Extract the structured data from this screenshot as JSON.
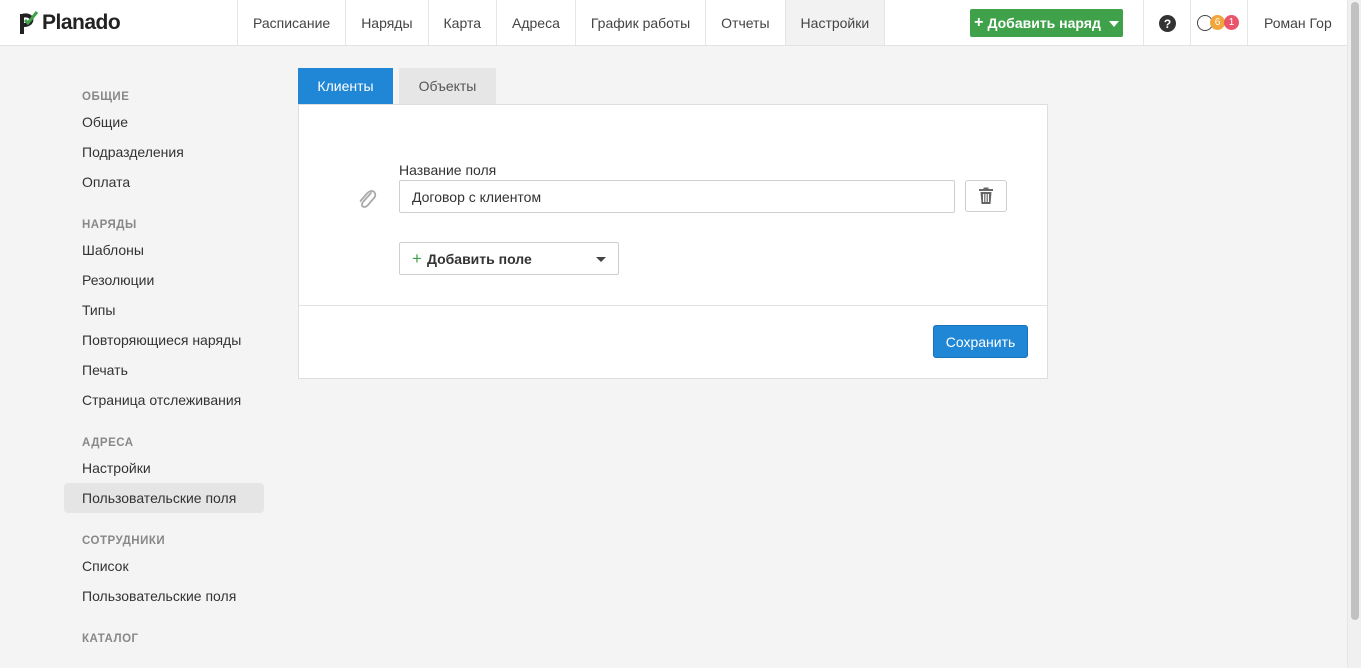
{
  "app": {
    "name": "Planado"
  },
  "nav": {
    "items": [
      {
        "label": "Расписание",
        "active": false
      },
      {
        "label": "Наряды",
        "active": false
      },
      {
        "label": "Карта",
        "active": false
      },
      {
        "label": "Адреса",
        "active": false
      },
      {
        "label": "График работы",
        "active": false
      },
      {
        "label": "Отчеты",
        "active": false
      },
      {
        "label": "Настройки",
        "active": true
      }
    ]
  },
  "header": {
    "add_order_label": "Добавить наряд",
    "help_label": "?",
    "badge_orange": "6",
    "badge_red": "1",
    "user_name": "Роман Гор"
  },
  "sidebar": {
    "sections": [
      {
        "title": "ОБЩИЕ",
        "items": [
          "Общие",
          "Подразделения",
          "Оплата"
        ]
      },
      {
        "title": "НАРЯДЫ",
        "items": [
          "Шаблоны",
          "Резолюции",
          "Типы",
          "Повторяющиеся наряды",
          "Печать",
          "Страница отслеживания"
        ]
      },
      {
        "title": "АДРЕСА",
        "items": [
          "Настройки",
          "Пользовательские поля"
        ]
      },
      {
        "title": "СОТРУДНИКИ",
        "items": [
          "Список",
          "Пользовательские поля"
        ]
      },
      {
        "title": "КАТАЛОГ",
        "items": []
      }
    ],
    "active_item": "Пользовательские поля"
  },
  "tabs": [
    {
      "label": "Клиенты",
      "active": true
    },
    {
      "label": "Объекты",
      "active": false
    }
  ],
  "form": {
    "field_label": "Название поля",
    "field_value": "Договор с клиентом",
    "add_field_label": "Добавить поле",
    "save_label": "Сохранить"
  },
  "colors": {
    "primary": "#1f87d5",
    "success": "#3fa24a",
    "badge_orange": "#f0a63a",
    "badge_red": "#e9546b"
  }
}
